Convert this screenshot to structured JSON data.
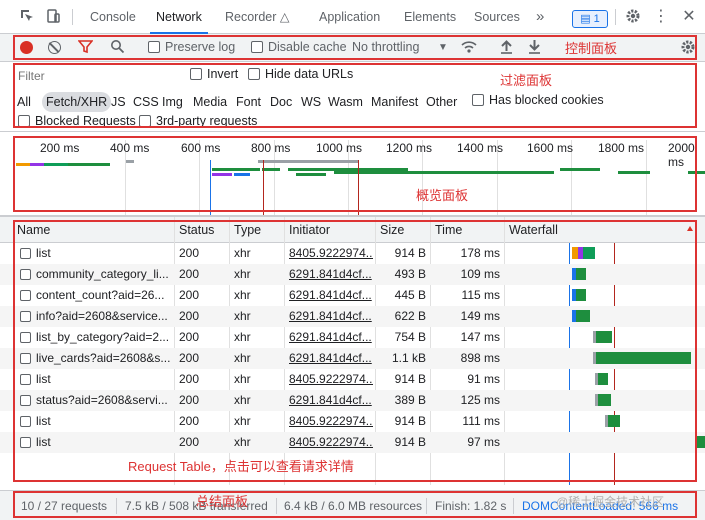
{
  "tabs": {
    "console": "Console",
    "network": "Network",
    "recorder": "Recorder",
    "application": "Application",
    "elements": "Elements",
    "sources": "Sources",
    "more": "»",
    "badge": "1"
  },
  "control": {
    "preserve_log": "Preserve log",
    "disable_cache": "Disable cache",
    "throttling": "No throttling",
    "annotation": "控制面板"
  },
  "filter": {
    "placeholder": "Filter",
    "invert": "Invert",
    "hide_data_urls": "Hide data URLs",
    "types": [
      "All",
      "Fetch/XHR",
      "JS",
      "CSS",
      "Img",
      "Media",
      "Font",
      "Doc",
      "WS",
      "Wasm",
      "Manifest",
      "Other"
    ],
    "has_blocked_cookies": "Has blocked cookies",
    "blocked_requests": "Blocked Requests",
    "third_party": "3rd-party requests",
    "annotation": "过滤面板"
  },
  "overview": {
    "ticks": [
      "200 ms",
      "400 ms",
      "600 ms",
      "800 ms",
      "1000 ms",
      "1200 ms",
      "1400 ms",
      "1600 ms",
      "1800 ms",
      "2000 ms"
    ],
    "annotation": "概览面板"
  },
  "table": {
    "headers": {
      "name": "Name",
      "status": "Status",
      "type": "Type",
      "initiator": "Initiator",
      "size": "Size",
      "time": "Time",
      "waterfall": "Waterfall"
    },
    "rows": [
      {
        "name": "list",
        "status": "200",
        "type": "xhr",
        "initiator": "8405.9222974...",
        "size": "914 B",
        "time": "178 ms"
      },
      {
        "name": "community_category_li...",
        "status": "200",
        "type": "xhr",
        "initiator": "6291.841d4cf...",
        "size": "493 B",
        "time": "109 ms"
      },
      {
        "name": "content_count?aid=26...",
        "status": "200",
        "type": "xhr",
        "initiator": "6291.841d4cf...",
        "size": "445 B",
        "time": "115 ms"
      },
      {
        "name": "info?aid=2608&service...",
        "status": "200",
        "type": "xhr",
        "initiator": "6291.841d4cf...",
        "size": "622 B",
        "time": "149 ms"
      },
      {
        "name": "list_by_category?aid=2...",
        "status": "200",
        "type": "xhr",
        "initiator": "6291.841d4cf...",
        "size": "754 B",
        "time": "147 ms"
      },
      {
        "name": "live_cards?aid=2608&s...",
        "status": "200",
        "type": "xhr",
        "initiator": "6291.841d4cf...",
        "size": "1.1 kB",
        "time": "898 ms"
      },
      {
        "name": "list",
        "status": "200",
        "type": "xhr",
        "initiator": "8405.9222974...",
        "size": "914 B",
        "time": "91 ms"
      },
      {
        "name": "status?aid=2608&servi...",
        "status": "200",
        "type": "xhr",
        "initiator": "6291.841d4cf...",
        "size": "389 B",
        "time": "125 ms"
      },
      {
        "name": "list",
        "status": "200",
        "type": "xhr",
        "initiator": "8405.9222974...",
        "size": "914 B",
        "time": "111 ms"
      },
      {
        "name": "list",
        "status": "200",
        "type": "xhr",
        "initiator": "8405.9222974...",
        "size": "914 B",
        "time": "97 ms"
      }
    ],
    "annotation": "Request Table，点击可以查看请求详情"
  },
  "summary": {
    "requests": "10 / 27 requests",
    "transferred": "7.5 kB / 508 kB transferred",
    "resources": "6.4 kB / 6.0 MB resources",
    "finish": "Finish: 1.82 s",
    "dcl": "DOMContentLoaded: 566 ms",
    "annotation": "总结面板",
    "watermark": "@稀土掘金技术社区"
  },
  "colors": {
    "accent": "#1a73e8",
    "annotation": "#dd3333",
    "record": "#d93025"
  }
}
